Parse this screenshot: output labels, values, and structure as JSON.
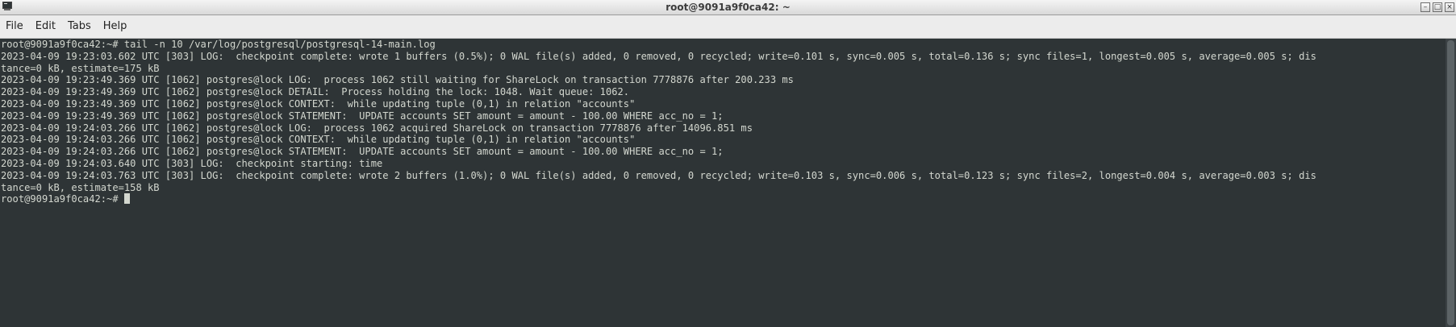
{
  "window": {
    "title": "root@9091a9f0ca42: ~",
    "icon": "terminal-icon",
    "controls": {
      "minimize": "minimize-icon",
      "maximize": "maximize-icon",
      "close": "close-icon"
    }
  },
  "menu": {
    "items": [
      "File",
      "Edit",
      "Tabs",
      "Help"
    ]
  },
  "terminal": {
    "lines": [
      "root@9091a9f0ca42:~# tail -n 10 /var/log/postgresql/postgresql-14-main.log",
      "2023-04-09 19:23:03.602 UTC [303] LOG:  checkpoint complete: wrote 1 buffers (0.5%); 0 WAL file(s) added, 0 removed, 0 recycled; write=0.101 s, sync=0.005 s, total=0.136 s; sync files=1, longest=0.005 s, average=0.005 s; dis",
      "tance=0 kB, estimate=175 kB",
      "2023-04-09 19:23:49.369 UTC [1062] postgres@lock LOG:  process 1062 still waiting for ShareLock on transaction 7778876 after 200.233 ms",
      "2023-04-09 19:23:49.369 UTC [1062] postgres@lock DETAIL:  Process holding the lock: 1048. Wait queue: 1062.",
      "2023-04-09 19:23:49.369 UTC [1062] postgres@lock CONTEXT:  while updating tuple (0,1) in relation \"accounts\"",
      "2023-04-09 19:23:49.369 UTC [1062] postgres@lock STATEMENT:  UPDATE accounts SET amount = amount - 100.00 WHERE acc_no = 1;",
      "2023-04-09 19:24:03.266 UTC [1062] postgres@lock LOG:  process 1062 acquired ShareLock on transaction 7778876 after 14096.851 ms",
      "2023-04-09 19:24:03.266 UTC [1062] postgres@lock CONTEXT:  while updating tuple (0,1) in relation \"accounts\"",
      "2023-04-09 19:24:03.266 UTC [1062] postgres@lock STATEMENT:  UPDATE accounts SET amount = amount - 100.00 WHERE acc_no = 1;",
      "2023-04-09 19:24:03.640 UTC [303] LOG:  checkpoint starting: time",
      "2023-04-09 19:24:03.763 UTC [303] LOG:  checkpoint complete: wrote 2 buffers (1.0%); 0 WAL file(s) added, 0 removed, 0 recycled; write=0.103 s, sync=0.006 s, total=0.123 s; sync files=2, longest=0.004 s, average=0.003 s; dis",
      "tance=0 kB, estimate=158 kB"
    ],
    "prompt": "root@9091a9f0ca42:~# "
  },
  "colors": {
    "background": "#2e3436",
    "foreground": "#d3d7cf"
  }
}
